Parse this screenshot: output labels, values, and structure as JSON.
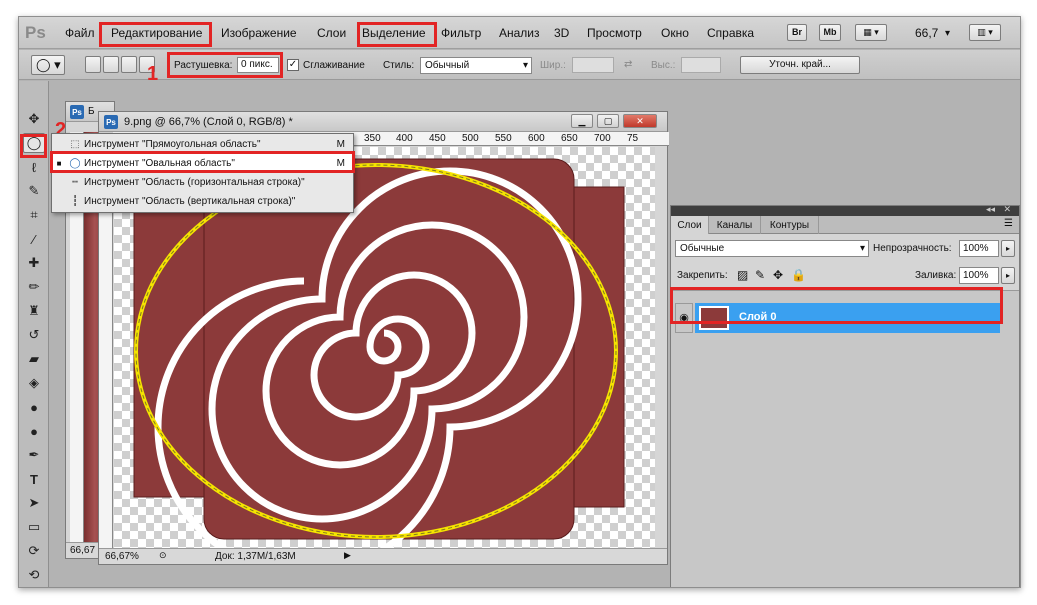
{
  "app": {
    "logo": "Ps"
  },
  "menu": {
    "items": [
      "Файл",
      "Редактирование",
      "Изображение",
      "Слои",
      "Выделение",
      "Фильтр",
      "Анализ",
      "3D",
      "Просмотр",
      "Окно",
      "Справка"
    ],
    "br_label": "Br",
    "mb_label": "Mb",
    "zoom": "66,7"
  },
  "options": {
    "feather_label": "Растушевка:",
    "feather_value": "0 пикс.",
    "antialias_label": "Сглаживание",
    "antialias_checked": true,
    "style_label": "Стиль:",
    "style_value": "Обычный",
    "width_label": "Шир.:",
    "height_label": "Выс.:",
    "refine_button": "Уточн. край..."
  },
  "annotations": {
    "step1": "1",
    "step2": "2"
  },
  "documents": {
    "back": {
      "title": "Б",
      "zoom": "66,67"
    },
    "front": {
      "title": "9.png @ 66,7% (Слой 0, RGB/8) *",
      "status_zoom": "66,67%",
      "status_doc": "Док: 1,37M/1,63M",
      "ruler_ticks": [
        "350",
        "400",
        "450",
        "500",
        "550",
        "600",
        "650",
        "700",
        "75"
      ]
    }
  },
  "tool_flyout": {
    "items": [
      {
        "label": "Инструмент \"Прямоугольная область\"",
        "shortcut": "M",
        "selected": false
      },
      {
        "label": "Инструмент \"Овальная область\"",
        "shortcut": "M",
        "selected": true
      },
      {
        "label": "Инструмент \"Область (горизонтальная строка)\"",
        "shortcut": "",
        "selected": false
      },
      {
        "label": "Инструмент \"Область (вертикальная строка)\"",
        "shortcut": "",
        "selected": false
      }
    ]
  },
  "layers_panel": {
    "tabs": [
      "Слои",
      "Каналы",
      "Контуры"
    ],
    "blend_mode": "Обычные",
    "opacity_label": "Непрозрачность:",
    "opacity_value": "100%",
    "lock_label": "Закрепить:",
    "fill_label": "Заливка:",
    "fill_value": "100%",
    "layers": [
      {
        "name": "Слой 0",
        "visible": true,
        "selected": true
      }
    ]
  },
  "colors": {
    "highlight_red": "#e22424",
    "selection_yellow": "#f5e400",
    "layer_selected": "#3aa0f0",
    "spiral": "#8c3a3a"
  }
}
